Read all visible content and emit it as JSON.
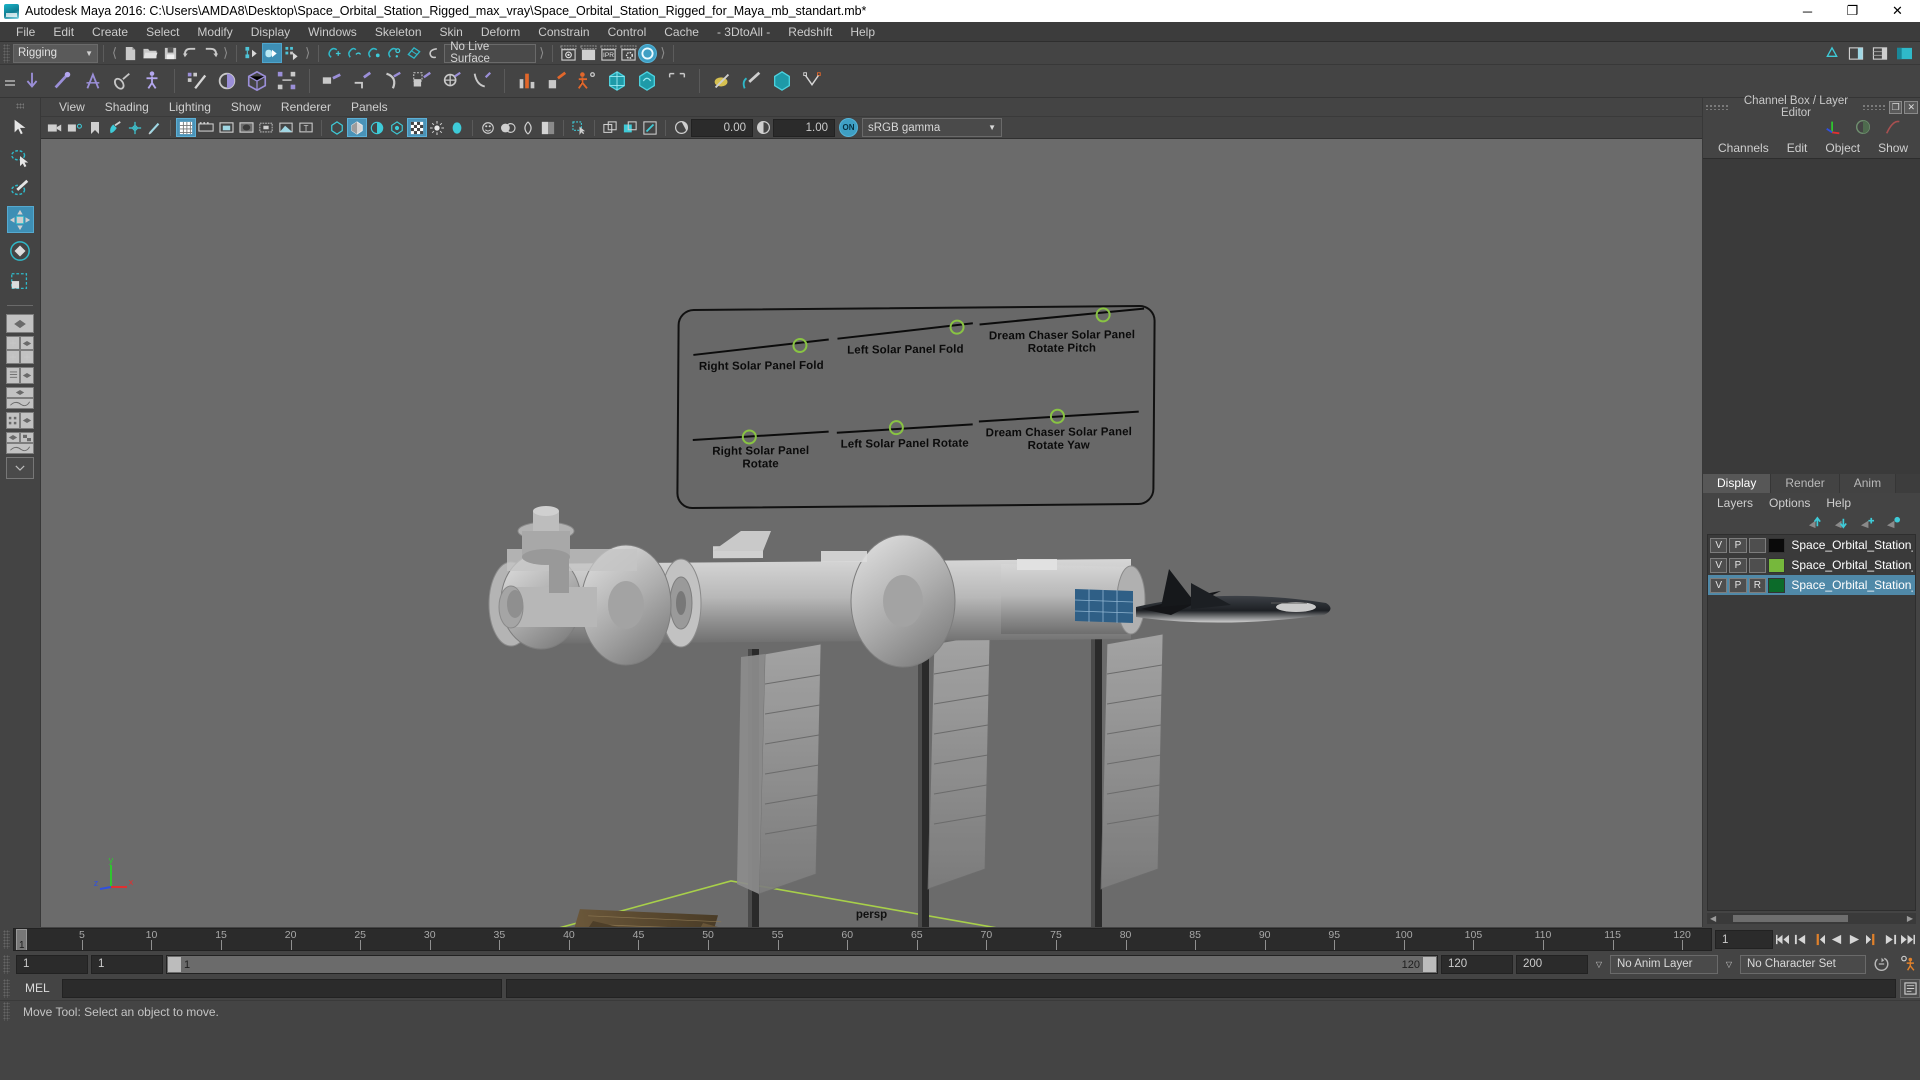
{
  "window": {
    "title": "Autodesk Maya 2016: C:\\Users\\AMDA8\\Desktop\\Space_Orbital_Station_Rigged_max_vray\\Space_Orbital_Station_Rigged_for_Maya_mb_standart.mb*",
    "minimize": "─",
    "maximize": "❐",
    "close": "✕"
  },
  "menubar": {
    "items": [
      {
        "label": "File"
      },
      {
        "label": "Edit"
      },
      {
        "label": "Create"
      },
      {
        "label": "Select"
      },
      {
        "label": "Modify"
      },
      {
        "label": "Display"
      },
      {
        "label": "Windows"
      },
      {
        "label": "Skeleton"
      },
      {
        "label": "Skin"
      },
      {
        "label": "Deform"
      },
      {
        "label": "Constrain"
      },
      {
        "label": "Control"
      },
      {
        "label": "Cache"
      },
      {
        "label": "- 3DtoAll -"
      },
      {
        "label": "Redshift"
      },
      {
        "label": "Help"
      }
    ]
  },
  "statusline": {
    "menuset": "Rigging",
    "menuset_arrow": "▼",
    "live_surface": "No Live Surface",
    "ipr_label": "IPR",
    "numeric_left": "0.00",
    "numeric_right": "1.00",
    "gamma_toggle": "ON",
    "gamma_value": "sRGB gamma",
    "gamma_arrow": "▼"
  },
  "viewport_menu": {
    "items": [
      {
        "label": "View"
      },
      {
        "label": "Shading"
      },
      {
        "label": "Lighting"
      },
      {
        "label": "Show"
      },
      {
        "label": "Renderer"
      },
      {
        "label": "Panels"
      }
    ]
  },
  "viewport": {
    "camera_label": "persp",
    "axis": {
      "x": "x",
      "y": "y",
      "z": "z"
    },
    "accent_green": "#89c443",
    "background": "#6b6b6b",
    "grid_color": "#a8d04a",
    "annotation_sliders": [
      {
        "label": "Right Solar Panel Fold",
        "knob_pct": 78
      },
      {
        "label": "Left Solar Panel Fold",
        "knob_pct": 88
      },
      {
        "label": "Dream Chaser Solar Panel\nRotate Pitch",
        "knob_pct": 72
      },
      {
        "label": "Right Solar Panel Rotate",
        "knob_pct": 40
      },
      {
        "label": "Left Solar Panel Rotate",
        "knob_pct": 45
      },
      {
        "label": "Dream Chaser Solar Panel\nRotate Yaw",
        "knob_pct": 46
      }
    ]
  },
  "channel_box": {
    "panel_title": "Channel Box / Layer Editor",
    "undock_icon": "❐",
    "close_icon": "✕",
    "menu": [
      {
        "label": "Channels"
      },
      {
        "label": "Edit"
      },
      {
        "label": "Object"
      },
      {
        "label": "Show"
      }
    ]
  },
  "layer_editor": {
    "tabs": [
      {
        "label": "Display",
        "active": true
      },
      {
        "label": "Render",
        "active": false
      },
      {
        "label": "Anim",
        "active": false
      }
    ],
    "menu": [
      {
        "label": "Layers"
      },
      {
        "label": "Options"
      },
      {
        "label": "Help"
      }
    ],
    "layers": [
      {
        "v": "V",
        "p": "P",
        "r": "",
        "color": "#0a0a0a",
        "name": "Space_Orbital_Station_",
        "selected": false
      },
      {
        "v": "V",
        "p": "P",
        "r": "",
        "color": "#76b83c",
        "name": "Space_Orbital_Station_",
        "selected": false
      },
      {
        "v": "V",
        "p": "P",
        "r": "R",
        "color": "#0c6b2a",
        "name": "Space_Orbital_Station_",
        "selected": true
      }
    ]
  },
  "timeline": {
    "start": 1,
    "end": 120,
    "current_frame": "1",
    "current_frame_marker": "1",
    "ticks": [
      5,
      10,
      15,
      20,
      25,
      30,
      35,
      40,
      45,
      50,
      55,
      60,
      65,
      70,
      75,
      80,
      85,
      90,
      95,
      100,
      105,
      110,
      115,
      120
    ],
    "playback_buttons": [
      {
        "name": "go-to-start",
        "glyph": "⏮"
      },
      {
        "name": "step-back-key",
        "glyph": "⏴|"
      },
      {
        "name": "step-back-frame",
        "glyph": "|⏴"
      },
      {
        "name": "play-backwards",
        "glyph": "◀"
      },
      {
        "name": "play-forwards",
        "glyph": "▶"
      },
      {
        "name": "step-forward-frame",
        "glyph": "⏵|"
      },
      {
        "name": "step-forward-key",
        "glyph": "|⏵"
      },
      {
        "name": "go-to-end",
        "glyph": "⏭"
      }
    ]
  },
  "range_slider": {
    "anim_start": "1",
    "anim_end": "1",
    "range_start": "1",
    "range_end": "120",
    "playback_end": "120",
    "anim_end_total": "200",
    "anim_layer": "No Anim Layer",
    "character_set": "No Character Set",
    "dropdown_arrow": "▽"
  },
  "command_line": {
    "language": "MEL",
    "value": "",
    "placeholder": ""
  },
  "help_line": {
    "text": "Move Tool: Select an object to move."
  }
}
